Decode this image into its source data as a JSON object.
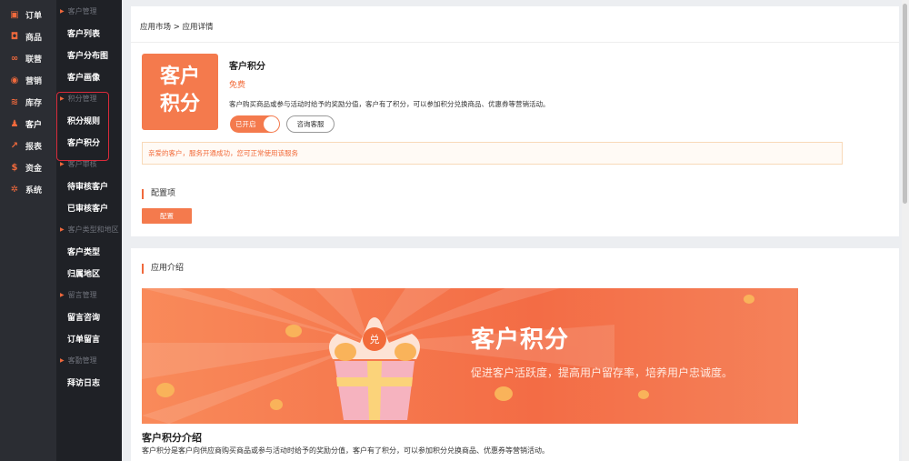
{
  "nav_primary": [
    {
      "label": "订单",
      "icon": "order-icon",
      "glyph": "▣"
    },
    {
      "label": "商品",
      "icon": "bag-icon",
      "glyph": "◘"
    },
    {
      "label": "联营",
      "icon": "share-icon",
      "glyph": "∞"
    },
    {
      "label": "营销",
      "icon": "broadcast-icon",
      "glyph": "◉"
    },
    {
      "label": "库存",
      "icon": "layers-icon",
      "glyph": "≋"
    },
    {
      "label": "客户",
      "icon": "user-icon",
      "glyph": "♟"
    },
    {
      "label": "报表",
      "icon": "chart-icon",
      "glyph": "↗"
    },
    {
      "label": "资金",
      "icon": "dollar-icon",
      "glyph": "$"
    },
    {
      "label": "系统",
      "icon": "gear-icon",
      "glyph": "✲"
    }
  ],
  "nav_secondary": [
    {
      "group": "客户管理",
      "items": [
        "客户列表",
        "客户分布图",
        "客户画像"
      ]
    },
    {
      "group": "积分管理",
      "items": [
        "积分规则",
        "客户积分"
      ]
    },
    {
      "group": "客户审核",
      "items": [
        "待审核客户",
        "已审核客户"
      ]
    },
    {
      "group": "客户类型和地区",
      "items": [
        "客户类型",
        "归属地区"
      ]
    },
    {
      "group": "留言管理",
      "items": [
        "留言咨询",
        "订单留言"
      ]
    },
    {
      "group": "客勤管理",
      "items": [
        "拜访日志"
      ]
    }
  ],
  "breadcrumb": "应用市场 > 应用详情",
  "app": {
    "logo_line1": "客户",
    "logo_line2": "积分",
    "name": "客户积分",
    "price": "免费",
    "description": "客户购买商品或参与活动时给予的奖励分值，客户有了积分，可以参加积分兑换商品、优惠券等营销活动。",
    "toggle_label": "已开启",
    "toggle_on": true,
    "consult_label": "咨询客服",
    "notice": "亲爱的客户，服务开通成功，您可正常使用该服务"
  },
  "config": {
    "title": "配置项",
    "button": "配置"
  },
  "intro": {
    "section_title": "应用介绍",
    "banner_title": "客户积分",
    "banner_subtitle": "促进客户活跃度，提高用户留存率，培养用户忠诚度。",
    "banner_coin_char": "兑",
    "title": "客户积分介绍",
    "text": "客户积分是客户向供应商购买商品或参与活动时给予的奖励分值，客户有了积分，可以参加积分兑换商品、优惠券等营销活动。"
  },
  "colors": {
    "accent": "#f47a4d",
    "sidebar": "#2b2d33",
    "sidebar_secondary": "#1f2126",
    "highlight_box": "#d92a3a"
  }
}
